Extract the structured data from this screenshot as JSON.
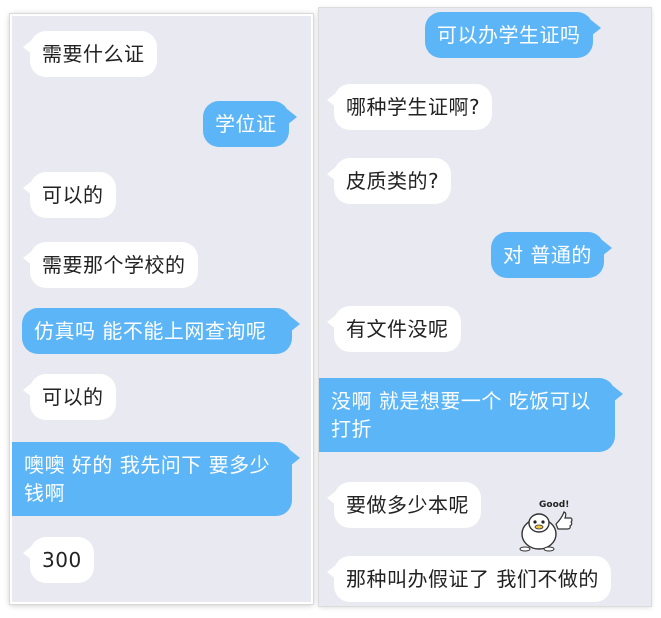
{
  "left_panel": {
    "messages": [
      {
        "side": "incoming",
        "text": "需要什么证"
      },
      {
        "side": "outgoing",
        "text": "学位证"
      },
      {
        "side": "incoming",
        "text": "可以的"
      },
      {
        "side": "incoming",
        "text": "需要那个学校的"
      },
      {
        "side": "outgoing",
        "text": "仿真吗 能不能上网查询呢"
      },
      {
        "side": "incoming",
        "text": "可以的"
      },
      {
        "side": "outgoing",
        "text": "噢噢 好的 我先问下 要多少钱啊"
      },
      {
        "side": "incoming",
        "text": "300"
      }
    ]
  },
  "right_panel": {
    "messages": [
      {
        "side": "outgoing",
        "text": "可以办学生证吗"
      },
      {
        "side": "incoming",
        "text": "哪种学生证啊?"
      },
      {
        "side": "incoming",
        "text": "皮质类的?"
      },
      {
        "side": "outgoing",
        "text": "对 普通的"
      },
      {
        "side": "incoming",
        "text": "有文件没呢"
      },
      {
        "side": "outgoing",
        "text": "没啊 就是想要一个 吃饭可以打折"
      },
      {
        "side": "incoming",
        "text": "要做多少本呢"
      },
      {
        "side": "incoming",
        "text": "那种叫办假证了 我们不做的"
      }
    ],
    "sticker": {
      "text": "Good!",
      "icon": "duck-thumbs-up-sticker"
    }
  },
  "colors": {
    "incoming_bubble": "#ffffff",
    "outgoing_bubble": "#5cb5f7",
    "background": "#e9e9f1"
  }
}
